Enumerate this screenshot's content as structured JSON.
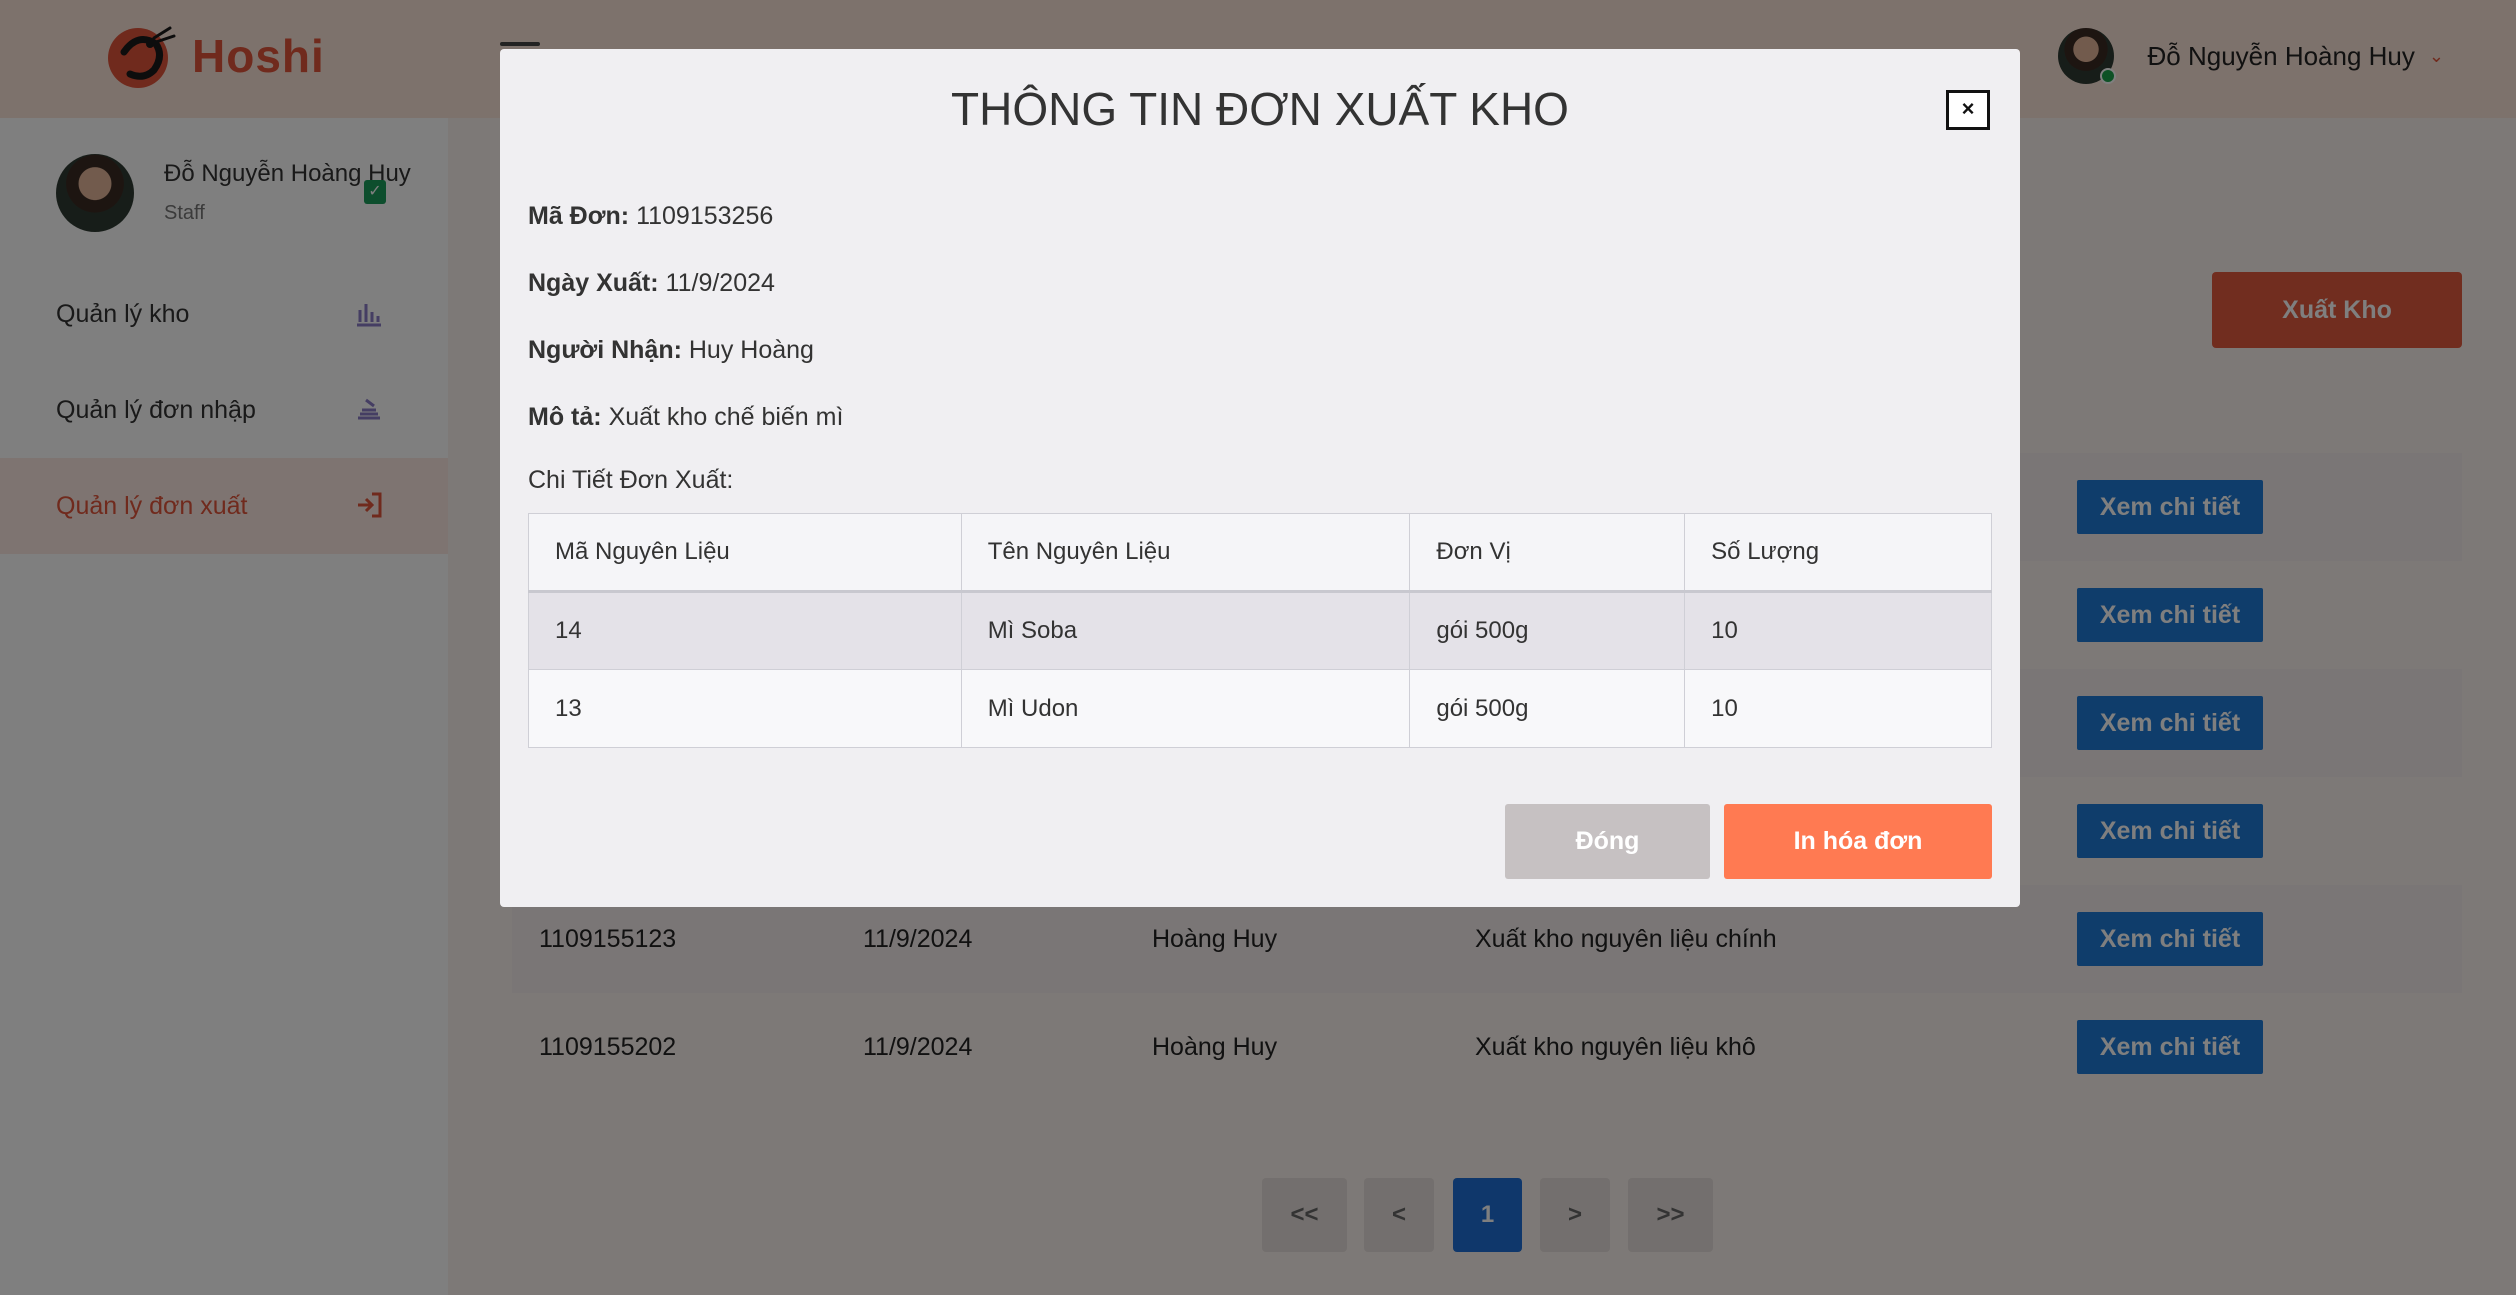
{
  "header": {
    "logo_text": "Hoshi",
    "user_name": "Đỗ Nguyễn Hoàng Huy"
  },
  "sidebar": {
    "profile_name": "Đỗ Nguyễn Hoàng Huy",
    "profile_role": "Staff",
    "items": [
      {
        "label": "Quản lý kho",
        "icon": "bar-chart-icon"
      },
      {
        "label": "Quản lý đơn nhập",
        "icon": "stack-icon"
      },
      {
        "label": "Quản lý đơn xuất",
        "icon": "export-icon",
        "active": true
      }
    ]
  },
  "main": {
    "create_button": "Xuất Kho",
    "detail_button": "Xem chi tiết",
    "rows": [
      {
        "code": "1109155123",
        "date": "11/9/2024",
        "receiver": "Hoàng Huy",
        "desc": "Xuất kho nguyên liệu chính"
      },
      {
        "code": "1109155202",
        "date": "11/9/2024",
        "receiver": "Hoàng Huy",
        "desc": "Xuất kho nguyên liệu khô"
      }
    ],
    "pagination": {
      "first": "<<",
      "prev": "<",
      "current": "1",
      "next": ">",
      "last": ">>"
    }
  },
  "modal": {
    "title": "THÔNG TIN ĐƠN XUẤT KHO",
    "close_label": "×",
    "fields": [
      {
        "label": "Mã Đơn:",
        "value": "1109153256"
      },
      {
        "label": "Ngày Xuất:",
        "value": "11/9/2024"
      },
      {
        "label": "Người Nhận:",
        "value": "Huy Hoàng"
      },
      {
        "label": "Mô tả:",
        "value": "Xuất kho chế biến mì"
      }
    ],
    "detail_label": "Chi Tiết Đơn Xuất:",
    "columns": [
      "Mã Nguyên Liệu",
      "Tên Nguyên Liệu",
      "Đơn Vị",
      "Số Lượng"
    ],
    "items": [
      [
        "14",
        "Mì Soba",
        "gói 500g",
        "10"
      ],
      [
        "13",
        "Mì Udon",
        "gói 500g",
        "10"
      ]
    ],
    "close_button": "Đóng",
    "print_button": "In hóa đơn"
  },
  "colors": {
    "accent": "#e35a3f",
    "primary_blue": "#1f7ad6",
    "print_orange": "#ff7a52"
  }
}
